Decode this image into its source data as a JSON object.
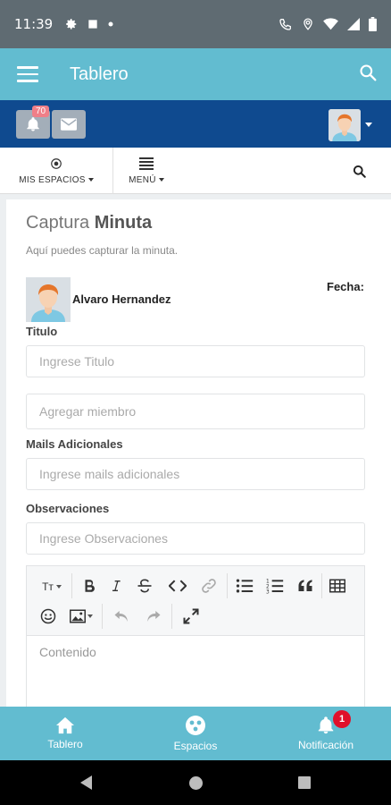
{
  "status_bar": {
    "time": "11:39"
  },
  "app_bar": {
    "title": "Tablero"
  },
  "header": {
    "notifications_count": "70"
  },
  "sub_nav": {
    "spaces_label": "MIS ESPACIOS",
    "menu_label": "MENÚ"
  },
  "form": {
    "title_light": "Captura",
    "title_bold": "Minuta",
    "subtitle": "Aquí puedes capturar la minuta.",
    "author_name": "Alvaro Hernandez",
    "date_label": "Fecha:",
    "titulo_label": "Titulo",
    "titulo_placeholder": "Ingrese Titulo",
    "member_placeholder": "Agregar miembro",
    "mails_label": "Mails Adicionales",
    "mails_placeholder": "Ingrese mails adicionales",
    "observ_label": "Observaciones",
    "observ_placeholder": "Ingrese Observaciones",
    "content_placeholder": "Contenido",
    "toolbar": {
      "font_size": "Tт"
    }
  },
  "bottom_nav": {
    "items": [
      {
        "label": "Tablero",
        "icon": "home-icon"
      },
      {
        "label": "Espacios",
        "icon": "spaces-icon"
      },
      {
        "label": "Notificación",
        "icon": "bell-icon",
        "badge": "1"
      }
    ]
  },
  "colors": {
    "accent": "#62bcd0",
    "header_blue": "#0f4a8f",
    "status_bar": "#5f6b72"
  }
}
